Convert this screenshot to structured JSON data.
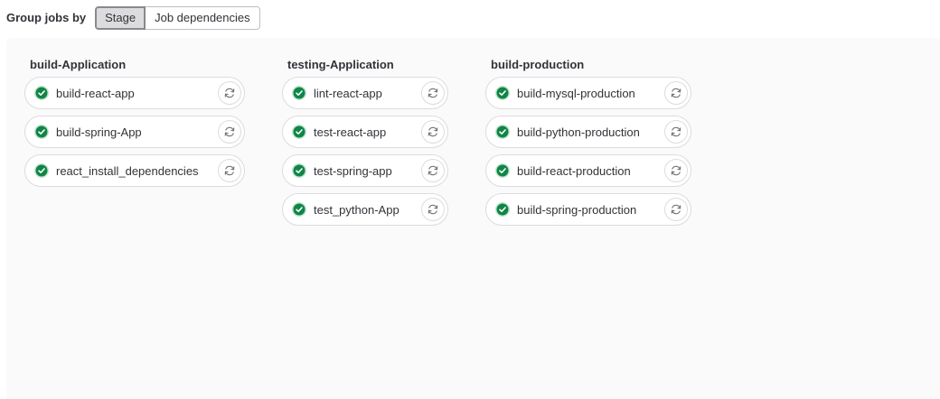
{
  "toolbar": {
    "label": "Group jobs by",
    "options": [
      "Stage",
      "Job dependencies"
    ],
    "selected": "Stage"
  },
  "colors": {
    "success": "#108548",
    "success_ring": "#c3e6cd",
    "text": "#333238",
    "panel_bg": "#fafafb"
  },
  "stages": [
    {
      "name": "build-Application",
      "jobs": [
        {
          "name": "build-react-app",
          "status": "success",
          "action": "retry"
        },
        {
          "name": "build-spring-App",
          "status": "success",
          "action": "retry"
        },
        {
          "name": "react_install_dependencies",
          "status": "success",
          "action": "retry"
        }
      ]
    },
    {
      "name": "testing-Application",
      "jobs": [
        {
          "name": "lint-react-app",
          "status": "success",
          "action": "retry"
        },
        {
          "name": "test-react-app",
          "status": "success",
          "action": "retry"
        },
        {
          "name": "test-spring-app",
          "status": "success",
          "action": "retry"
        },
        {
          "name": "test_python-App",
          "status": "success",
          "action": "retry"
        }
      ]
    },
    {
      "name": "build-production",
      "jobs": [
        {
          "name": "build-mysql-production",
          "status": "success",
          "action": "retry"
        },
        {
          "name": "build-python-production",
          "status": "success",
          "action": "retry"
        },
        {
          "name": "build-react-production",
          "status": "success",
          "action": "retry"
        },
        {
          "name": "build-spring-production",
          "status": "success",
          "action": "retry"
        }
      ]
    }
  ]
}
